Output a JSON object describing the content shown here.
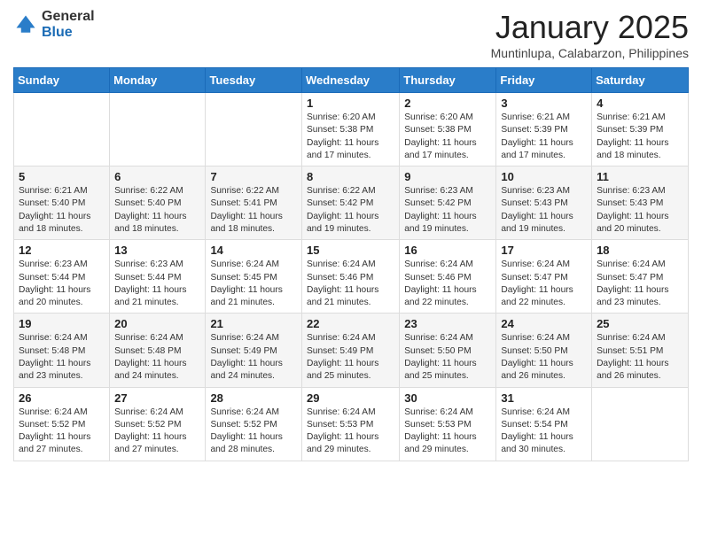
{
  "logo": {
    "general": "General",
    "blue": "Blue"
  },
  "title": "January 2025",
  "subtitle": "Muntinlupa, Calabarzon, Philippines",
  "days_of_week": [
    "Sunday",
    "Monday",
    "Tuesday",
    "Wednesday",
    "Thursday",
    "Friday",
    "Saturday"
  ],
  "weeks": [
    [
      {
        "day": "",
        "sunrise": "",
        "sunset": "",
        "daylight": ""
      },
      {
        "day": "",
        "sunrise": "",
        "sunset": "",
        "daylight": ""
      },
      {
        "day": "",
        "sunrise": "",
        "sunset": "",
        "daylight": ""
      },
      {
        "day": "1",
        "sunrise": "Sunrise: 6:20 AM",
        "sunset": "Sunset: 5:38 PM",
        "daylight": "Daylight: 11 hours and 17 minutes."
      },
      {
        "day": "2",
        "sunrise": "Sunrise: 6:20 AM",
        "sunset": "Sunset: 5:38 PM",
        "daylight": "Daylight: 11 hours and 17 minutes."
      },
      {
        "day": "3",
        "sunrise": "Sunrise: 6:21 AM",
        "sunset": "Sunset: 5:39 PM",
        "daylight": "Daylight: 11 hours and 17 minutes."
      },
      {
        "day": "4",
        "sunrise": "Sunrise: 6:21 AM",
        "sunset": "Sunset: 5:39 PM",
        "daylight": "Daylight: 11 hours and 18 minutes."
      }
    ],
    [
      {
        "day": "5",
        "sunrise": "Sunrise: 6:21 AM",
        "sunset": "Sunset: 5:40 PM",
        "daylight": "Daylight: 11 hours and 18 minutes."
      },
      {
        "day": "6",
        "sunrise": "Sunrise: 6:22 AM",
        "sunset": "Sunset: 5:40 PM",
        "daylight": "Daylight: 11 hours and 18 minutes."
      },
      {
        "day": "7",
        "sunrise": "Sunrise: 6:22 AM",
        "sunset": "Sunset: 5:41 PM",
        "daylight": "Daylight: 11 hours and 18 minutes."
      },
      {
        "day": "8",
        "sunrise": "Sunrise: 6:22 AM",
        "sunset": "Sunset: 5:42 PM",
        "daylight": "Daylight: 11 hours and 19 minutes."
      },
      {
        "day": "9",
        "sunrise": "Sunrise: 6:23 AM",
        "sunset": "Sunset: 5:42 PM",
        "daylight": "Daylight: 11 hours and 19 minutes."
      },
      {
        "day": "10",
        "sunrise": "Sunrise: 6:23 AM",
        "sunset": "Sunset: 5:43 PM",
        "daylight": "Daylight: 11 hours and 19 minutes."
      },
      {
        "day": "11",
        "sunrise": "Sunrise: 6:23 AM",
        "sunset": "Sunset: 5:43 PM",
        "daylight": "Daylight: 11 hours and 20 minutes."
      }
    ],
    [
      {
        "day": "12",
        "sunrise": "Sunrise: 6:23 AM",
        "sunset": "Sunset: 5:44 PM",
        "daylight": "Daylight: 11 hours and 20 minutes."
      },
      {
        "day": "13",
        "sunrise": "Sunrise: 6:23 AM",
        "sunset": "Sunset: 5:44 PM",
        "daylight": "Daylight: 11 hours and 21 minutes."
      },
      {
        "day": "14",
        "sunrise": "Sunrise: 6:24 AM",
        "sunset": "Sunset: 5:45 PM",
        "daylight": "Daylight: 11 hours and 21 minutes."
      },
      {
        "day": "15",
        "sunrise": "Sunrise: 6:24 AM",
        "sunset": "Sunset: 5:46 PM",
        "daylight": "Daylight: 11 hours and 21 minutes."
      },
      {
        "day": "16",
        "sunrise": "Sunrise: 6:24 AM",
        "sunset": "Sunset: 5:46 PM",
        "daylight": "Daylight: 11 hours and 22 minutes."
      },
      {
        "day": "17",
        "sunrise": "Sunrise: 6:24 AM",
        "sunset": "Sunset: 5:47 PM",
        "daylight": "Daylight: 11 hours and 22 minutes."
      },
      {
        "day": "18",
        "sunrise": "Sunrise: 6:24 AM",
        "sunset": "Sunset: 5:47 PM",
        "daylight": "Daylight: 11 hours and 23 minutes."
      }
    ],
    [
      {
        "day": "19",
        "sunrise": "Sunrise: 6:24 AM",
        "sunset": "Sunset: 5:48 PM",
        "daylight": "Daylight: 11 hours and 23 minutes."
      },
      {
        "day": "20",
        "sunrise": "Sunrise: 6:24 AM",
        "sunset": "Sunset: 5:48 PM",
        "daylight": "Daylight: 11 hours and 24 minutes."
      },
      {
        "day": "21",
        "sunrise": "Sunrise: 6:24 AM",
        "sunset": "Sunset: 5:49 PM",
        "daylight": "Daylight: 11 hours and 24 minutes."
      },
      {
        "day": "22",
        "sunrise": "Sunrise: 6:24 AM",
        "sunset": "Sunset: 5:49 PM",
        "daylight": "Daylight: 11 hours and 25 minutes."
      },
      {
        "day": "23",
        "sunrise": "Sunrise: 6:24 AM",
        "sunset": "Sunset: 5:50 PM",
        "daylight": "Daylight: 11 hours and 25 minutes."
      },
      {
        "day": "24",
        "sunrise": "Sunrise: 6:24 AM",
        "sunset": "Sunset: 5:50 PM",
        "daylight": "Daylight: 11 hours and 26 minutes."
      },
      {
        "day": "25",
        "sunrise": "Sunrise: 6:24 AM",
        "sunset": "Sunset: 5:51 PM",
        "daylight": "Daylight: 11 hours and 26 minutes."
      }
    ],
    [
      {
        "day": "26",
        "sunrise": "Sunrise: 6:24 AM",
        "sunset": "Sunset: 5:52 PM",
        "daylight": "Daylight: 11 hours and 27 minutes."
      },
      {
        "day": "27",
        "sunrise": "Sunrise: 6:24 AM",
        "sunset": "Sunset: 5:52 PM",
        "daylight": "Daylight: 11 hours and 27 minutes."
      },
      {
        "day": "28",
        "sunrise": "Sunrise: 6:24 AM",
        "sunset": "Sunset: 5:52 PM",
        "daylight": "Daylight: 11 hours and 28 minutes."
      },
      {
        "day": "29",
        "sunrise": "Sunrise: 6:24 AM",
        "sunset": "Sunset: 5:53 PM",
        "daylight": "Daylight: 11 hours and 29 minutes."
      },
      {
        "day": "30",
        "sunrise": "Sunrise: 6:24 AM",
        "sunset": "Sunset: 5:53 PM",
        "daylight": "Daylight: 11 hours and 29 minutes."
      },
      {
        "day": "31",
        "sunrise": "Sunrise: 6:24 AM",
        "sunset": "Sunset: 5:54 PM",
        "daylight": "Daylight: 11 hours and 30 minutes."
      },
      {
        "day": "",
        "sunrise": "",
        "sunset": "",
        "daylight": ""
      }
    ]
  ]
}
